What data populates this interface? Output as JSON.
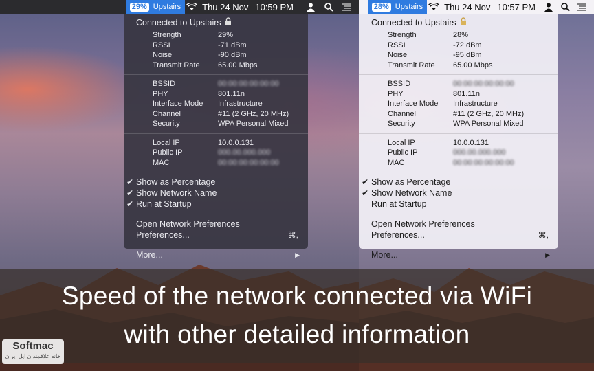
{
  "colors": {
    "wifi_accent": "#2f7be0",
    "caption_band": "#372f2a"
  },
  "panes": [
    {
      "theme": "dark",
      "menubar": {
        "wifi_percent": "29%",
        "network_name": "Upstairs",
        "date": "Thu 24 Nov",
        "time": "10:59 PM",
        "icons": [
          "wifi-icon",
          "user-icon",
          "search-icon",
          "notification-list-icon"
        ]
      },
      "menu": {
        "header": "Connected to Upstairs",
        "header_icon": "lock-icon",
        "signal": [
          {
            "label": "Strength",
            "value": "29%"
          },
          {
            "label": "RSSI",
            "value": "-71 dBm"
          },
          {
            "label": "Noise",
            "value": "-90 dBm"
          },
          {
            "label": "Transmit Rate",
            "value": "65.00 Mbps"
          }
        ],
        "link": [
          {
            "label": "BSSID",
            "value": "00:00:00:00:00:00"
          },
          {
            "label": "PHY",
            "value": "801.11n"
          },
          {
            "label": "Interface Mode",
            "value": "Infrastructure"
          },
          {
            "label": "Channel",
            "value": "#11 (2 GHz, 20 MHz)"
          },
          {
            "label": "Security",
            "value": "WPA Personal Mixed"
          }
        ],
        "addresses": [
          {
            "label": "Local IP",
            "value": "10.0.0.131"
          },
          {
            "label": "Public IP",
            "value": "000.00.000.000"
          },
          {
            "label": "MAC",
            "value": "00:00:00:00:00:00"
          }
        ],
        "options": [
          {
            "label": "Show as Percentage",
            "checked": true
          },
          {
            "label": "Show Network Name",
            "checked": true
          },
          {
            "label": "Run at Startup",
            "checked": true
          }
        ],
        "open_prefs": "Open Network Preferences",
        "preferences": "Preferences...",
        "preferences_shortcut": "⌘,",
        "more": "More...",
        "more_arrow": "▶"
      }
    },
    {
      "theme": "light",
      "menubar": {
        "wifi_percent": "28%",
        "network_name": "Upstairs",
        "date": "Thu 24 Nov",
        "time": "10:57 PM",
        "icons": [
          "wifi-icon",
          "user-icon",
          "search-icon",
          "notification-list-icon"
        ]
      },
      "menu": {
        "header": "Connected to Upstairs",
        "header_icon": "lock-icon",
        "signal": [
          {
            "label": "Strength",
            "value": "28%"
          },
          {
            "label": "RSSI",
            "value": "-72 dBm"
          },
          {
            "label": "Noise",
            "value": "-95 dBm"
          },
          {
            "label": "Transmit Rate",
            "value": "65.00 Mbps"
          }
        ],
        "link": [
          {
            "label": "BSSID",
            "value": "00:00:00:00:00:00"
          },
          {
            "label": "PHY",
            "value": "801.11n"
          },
          {
            "label": "Interface Mode",
            "value": "Infrastructure"
          },
          {
            "label": "Channel",
            "value": "#11 (2 GHz, 20 MHz)"
          },
          {
            "label": "Security",
            "value": "WPA Personal Mixed"
          }
        ],
        "addresses": [
          {
            "label": "Local IP",
            "value": "10.0.0.131"
          },
          {
            "label": "Public IP",
            "value": "000.00.000.000"
          },
          {
            "label": "MAC",
            "value": "00:00:00:00:00:00"
          }
        ],
        "options": [
          {
            "label": "Show as Percentage",
            "checked": true
          },
          {
            "label": "Show Network Name",
            "checked": true
          },
          {
            "label": "Run at Startup",
            "checked": false
          }
        ],
        "open_prefs": "Open Network Preferences",
        "preferences": "Preferences...",
        "preferences_shortcut": "⌘,",
        "more": "More...",
        "more_arrow": "▶"
      }
    }
  ],
  "caption": {
    "line1": "Speed of the network connected via WiFi",
    "line2": "with other detailed information"
  },
  "watermark": {
    "name": "Softmac",
    "subtitle": "خانه علاقمندان اپل ایران"
  }
}
